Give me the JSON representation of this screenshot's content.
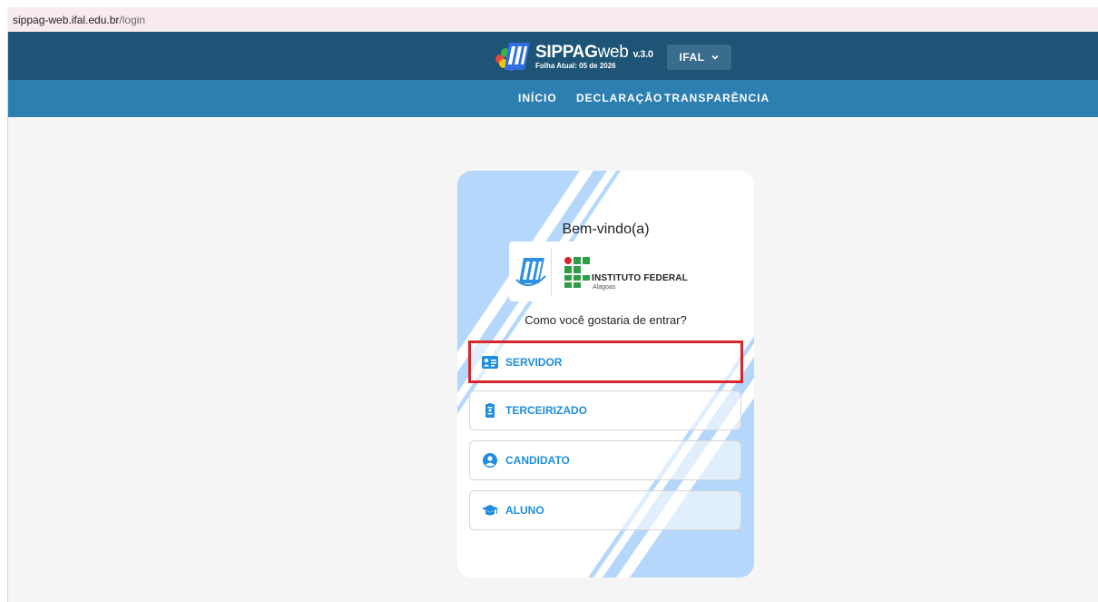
{
  "browser": {
    "url_host": "sippag-web.ifal.edu.br",
    "url_path": "/login"
  },
  "header": {
    "app_name_bold": "SIPPAG",
    "app_name_light": "web",
    "version": "v.3.0",
    "subtitle": "Folha Atual: 05 de 2026",
    "org_select": "IFAL"
  },
  "nav": {
    "items": [
      "INÍCIO",
      "DECLARAÇÃO",
      "TRANSPARÊNCIA"
    ]
  },
  "login_card": {
    "welcome": "Bem-vindo(a)",
    "institution_title": "INSTITUTO FEDERAL",
    "institution_sub": "Alagoas",
    "question": "Como você gostaria de entrar?",
    "options": [
      {
        "label": "SERVIDOR",
        "icon": "id-card-icon",
        "selected": true
      },
      {
        "label": "TERCEIRIZADO",
        "icon": "clipboard-badge-icon",
        "selected": false
      },
      {
        "label": "CANDIDATO",
        "icon": "user-circle-icon",
        "selected": false
      },
      {
        "label": "ALUNO",
        "icon": "graduation-cap-icon",
        "selected": false
      }
    ]
  },
  "colors": {
    "topbar": "#1e5475",
    "navbar": "#2d7fb1",
    "accent": "#1f8ee0",
    "highlight": "#d9262a",
    "stripes": "#b5d7fb"
  }
}
